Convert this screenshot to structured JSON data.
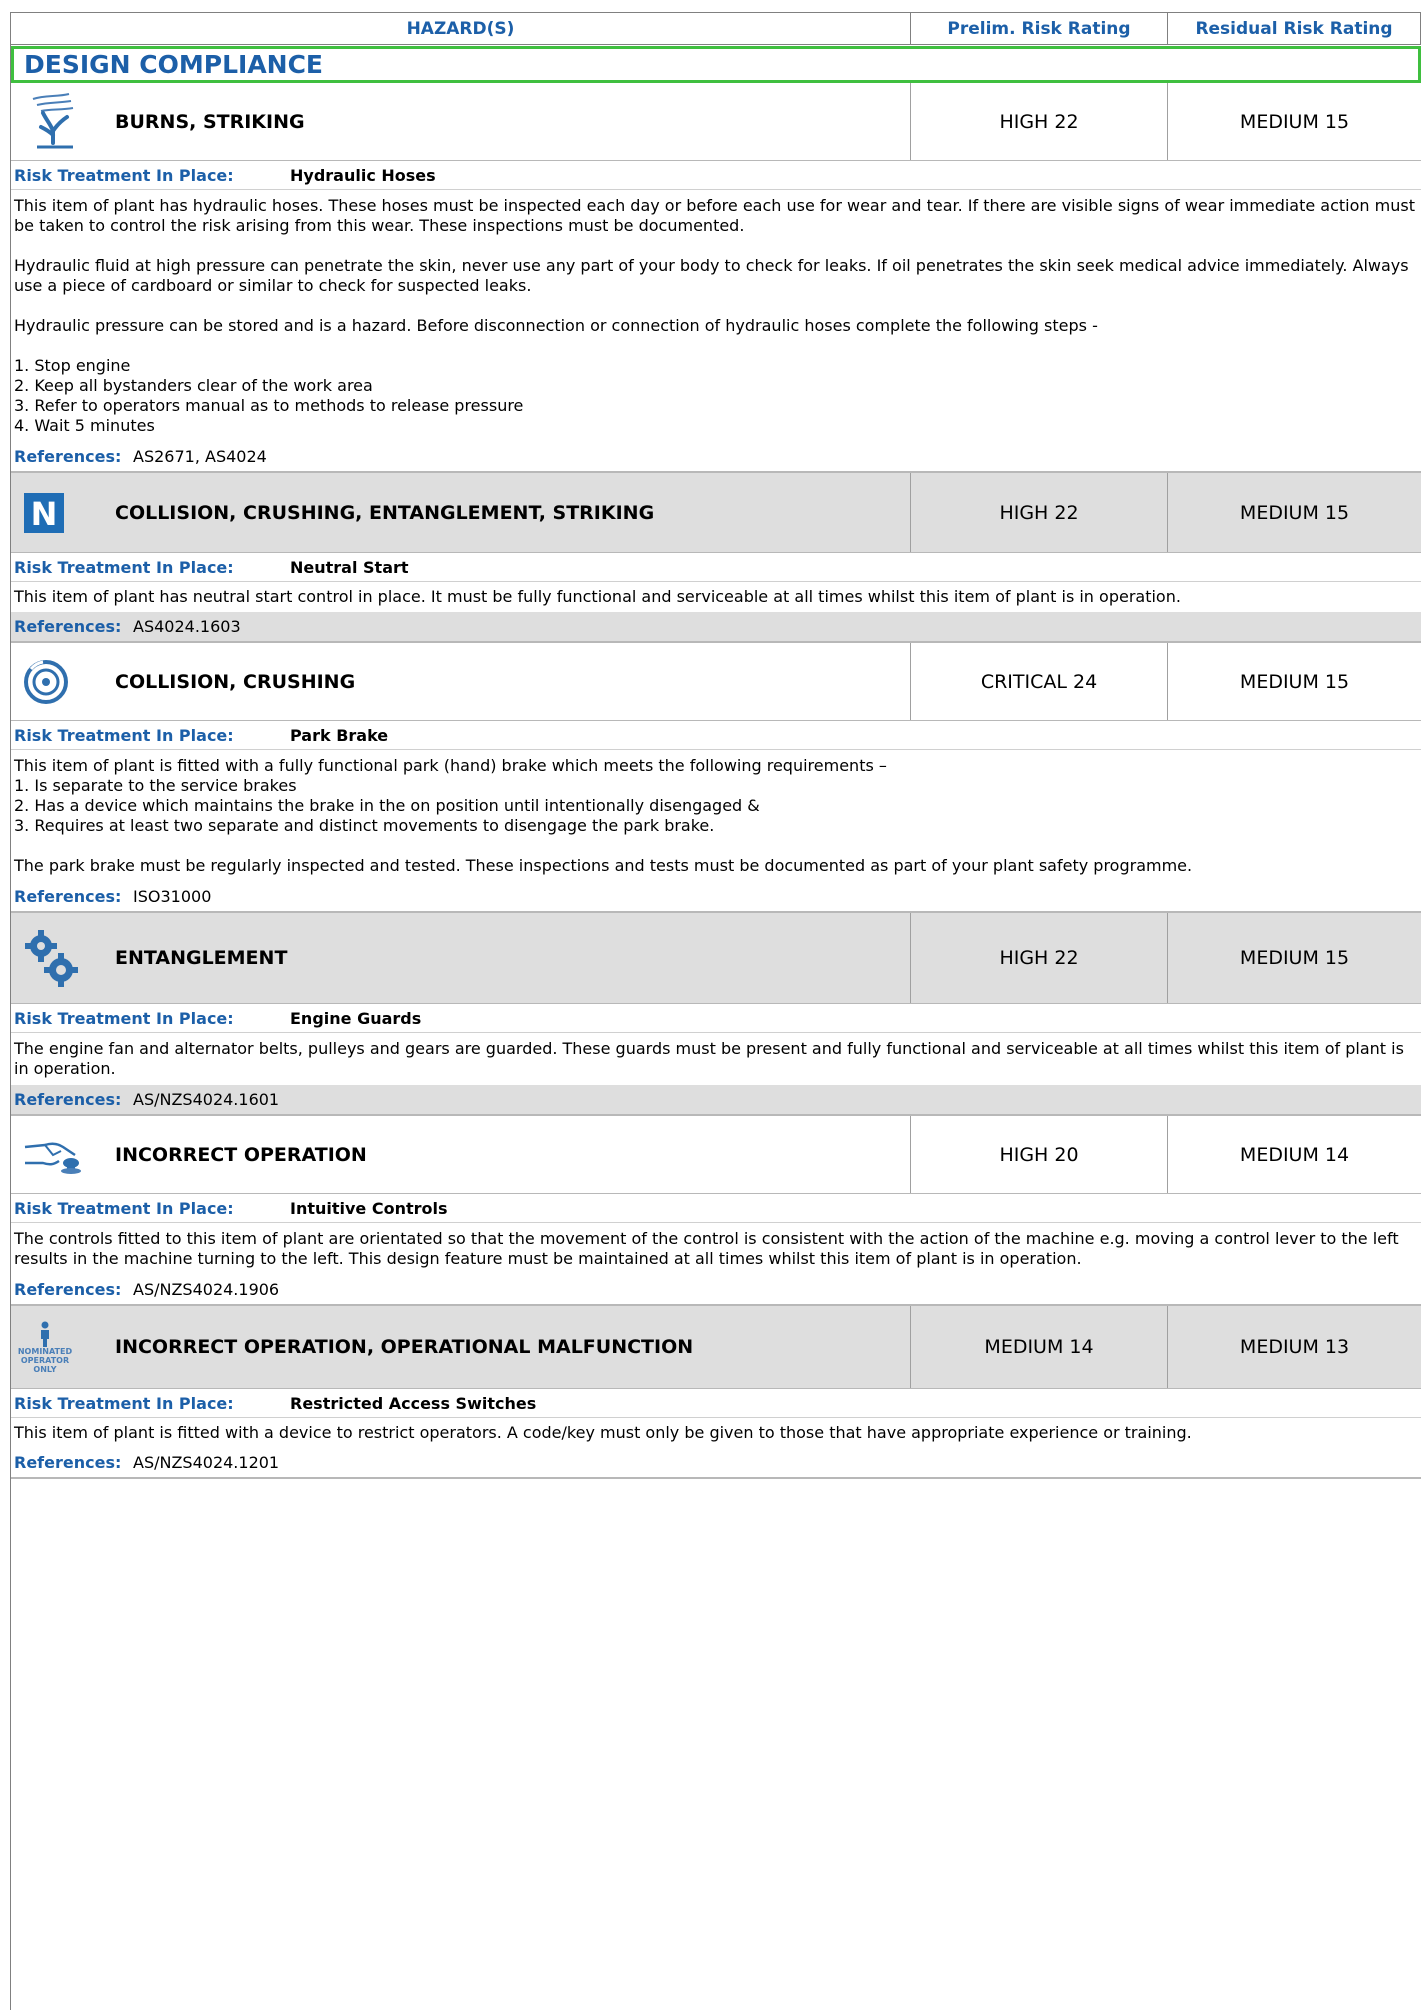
{
  "header": {
    "hazards": "HAZARD(S)",
    "prelim": "Prelim. Risk Rating",
    "residual": "Residual Risk Rating"
  },
  "section_title": "DESIGN COMPLIANCE",
  "labels": {
    "treatment": "Risk Treatment In Place:",
    "references": "References:"
  },
  "hazards": [
    {
      "icon": "burn-hand-icon",
      "title": "BURNS, STRIKING",
      "prelim": "HIGH 22",
      "residual": "MEDIUM 15",
      "treatment": "Hydraulic Hoses",
      "desc": [
        "This item of plant has hydraulic hoses. These hoses must be inspected each day or before each use for wear and tear. If there are visible signs of wear immediate action must be taken to control the risk arising from this wear. These inspections must be documented.",
        "",
        "Hydraulic fluid at high pressure can penetrate the skin, never use any part of your body to check for leaks. If oil penetrates the skin seek medical advice immediately. Always use a piece of cardboard or similar to check for suspected leaks.",
        "",
        "Hydraulic pressure can be stored and is a hazard. Before disconnection or connection of hydraulic hoses complete the following steps -",
        "",
        "1. Stop engine",
        "2. Keep all bystanders clear of the work area",
        "3. Refer to operators manual as to methods to release pressure",
        "4. Wait 5 minutes"
      ],
      "references": "AS2671, AS4024"
    },
    {
      "icon": "neutral-start-icon",
      "icon_letter": "N",
      "title": "COLLISION, CRUSHING, ENTANGLEMENT, STRIKING",
      "prelim": "HIGH 22",
      "residual": "MEDIUM 15",
      "treatment": "Neutral Start",
      "desc": [
        "This item of plant has neutral start control in place. It must be fully functional and serviceable at all times whilst this item of plant is in operation."
      ],
      "references": "AS4024.1603"
    },
    {
      "icon": "brake-disc-icon",
      "title": "COLLISION, CRUSHING",
      "prelim": "CRITICAL 24",
      "residual": "MEDIUM 15",
      "treatment": "Park Brake",
      "desc": [
        "This item of plant is fitted with a fully functional park (hand) brake which meets the following requirements –",
        "1. Is separate to the service brakes",
        "2. Has a device which maintains the brake in the on position until intentionally disengaged &",
        "3. Requires at least two separate and distinct movements to disengage the park brake.",
        "",
        "The park brake must be regularly inspected and tested. These inspections and tests must be documented as part of your plant safety programme."
      ],
      "references": "ISO31000"
    },
    {
      "icon": "gears-icon",
      "title": "ENTANGLEMENT",
      "prelim": "HIGH 22",
      "residual": "MEDIUM 15",
      "treatment": "Engine Guards",
      "desc": [
        "The engine fan and alternator belts, pulleys and gears are guarded. These guards must be present and fully functional and serviceable at all times whilst this item of plant is in operation."
      ],
      "references": "AS/NZS4024.1601"
    },
    {
      "icon": "hand-control-icon",
      "title": "INCORRECT OPERATION",
      "prelim": "HIGH 20",
      "residual": "MEDIUM 14",
      "treatment": "Intuitive Controls",
      "desc": [
        "The controls fitted to this item of plant are orientated so that the movement of the control is consistent with the action of the machine e.g. moving a control lever to the left results in the machine turning to the left. This design feature must be maintained at all times whilst this item of plant is in operation."
      ],
      "references": "AS/NZS4024.1906"
    },
    {
      "icon": "nominated-operator-icon",
      "icon_text": [
        "NOMINATED",
        "OPERATOR",
        "ONLY"
      ],
      "title": "INCORRECT OPERATION, OPERATIONAL MALFUNCTION",
      "prelim": "MEDIUM 14",
      "residual": "MEDIUM 13",
      "treatment": "Restricted Access Switches",
      "desc": [
        "This item of plant is fitted with a device to restrict operators. A code/key must only be given to those that have appropriate experience or training."
      ],
      "references": "AS/NZS4024.1201"
    }
  ],
  "colors": {
    "accent": "#1c5fa8",
    "banner_border": "#3fbf3f",
    "gray_row": "#dedede"
  }
}
